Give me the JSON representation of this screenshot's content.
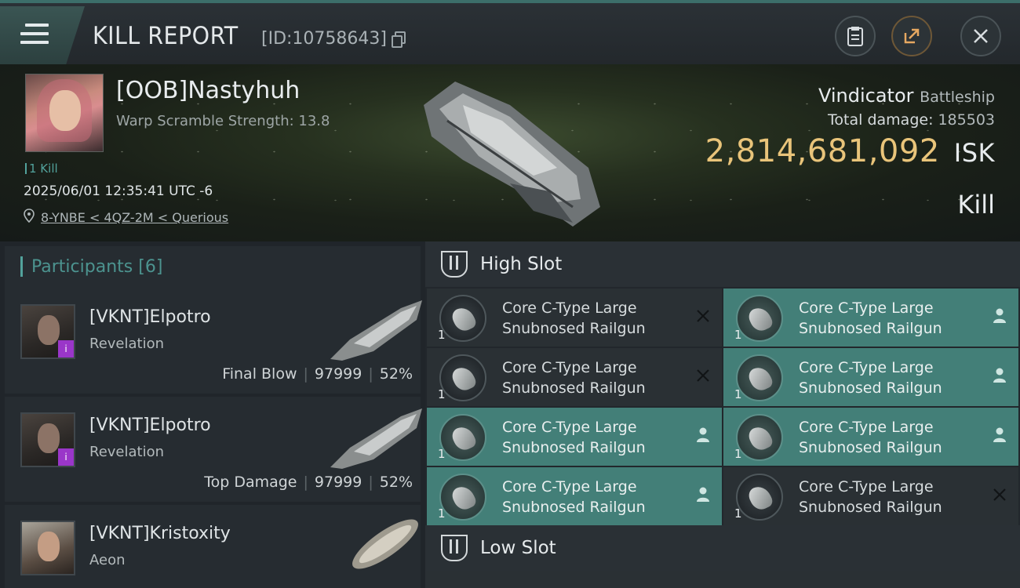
{
  "header": {
    "title": "KILL REPORT",
    "report_id": "[ID:10758643]",
    "menu_icon": "hamburger-icon",
    "clipboard_icon": "clipboard-icon",
    "share_icon": "share-icon",
    "close_icon": "close-icon"
  },
  "victim": {
    "name": "[OOB]Nastyhuh",
    "warp_scramble": "Warp Scramble Strength: 13.8",
    "kill_count": "1 Kill",
    "timestamp": "2025/06/01 12:35:41 UTC -6",
    "location": "8-YNBE < 4QZ-2M < Querious",
    "ship_name": "Vindicator",
    "ship_class": "Battleship",
    "total_damage_label": "Total damage:",
    "total_damage": "185503",
    "isk_value": "2,814,681,092",
    "isk_unit": "ISK",
    "result": "Kill"
  },
  "participants": {
    "label": "Participants",
    "count": "[6]",
    "rows": [
      {
        "name": "[VKNT]Elpotro",
        "ship": "Revelation",
        "role": "Final Blow",
        "damage": "97999",
        "percent": "52%"
      },
      {
        "name": "[VKNT]Elpotro",
        "ship": "Revelation",
        "role": "Top Damage",
        "damage": "97999",
        "percent": "52%"
      },
      {
        "name": "[VKNT]Kristoxity",
        "ship": "Aeon"
      }
    ]
  },
  "slots": {
    "high_label": "High Slot",
    "low_label": "Low Slot",
    "high_modules": [
      {
        "line1": "Core C-Type Large",
        "line2": "Snubnosed Railgun",
        "qty": "1",
        "state": "destroyed"
      },
      {
        "line1": "Core C-Type Large",
        "line2": "Snubnosed Railgun",
        "qty": "1",
        "state": "dropped"
      },
      {
        "line1": "Core C-Type Large",
        "line2": "Snubnosed Railgun",
        "qty": "1",
        "state": "destroyed"
      },
      {
        "line1": "Core C-Type Large",
        "line2": "Snubnosed Railgun",
        "qty": "1",
        "state": "dropped"
      },
      {
        "line1": "Core C-Type Large",
        "line2": "Snubnosed Railgun",
        "qty": "1",
        "state": "dropped"
      },
      {
        "line1": "Core C-Type Large",
        "line2": "Snubnosed Railgun",
        "qty": "1",
        "state": "dropped"
      },
      {
        "line1": "Core C-Type Large",
        "line2": "Snubnosed Railgun",
        "qty": "1",
        "state": "dropped"
      },
      {
        "line1": "Core C-Type Large",
        "line2": "Snubnosed Railgun",
        "qty": "1",
        "state": "destroyed"
      }
    ]
  },
  "colors": {
    "accent": "#52a29c",
    "isk": "#e9c47a",
    "dropped_bg": "#437f78",
    "destroyed_bg": "#2a3034"
  }
}
